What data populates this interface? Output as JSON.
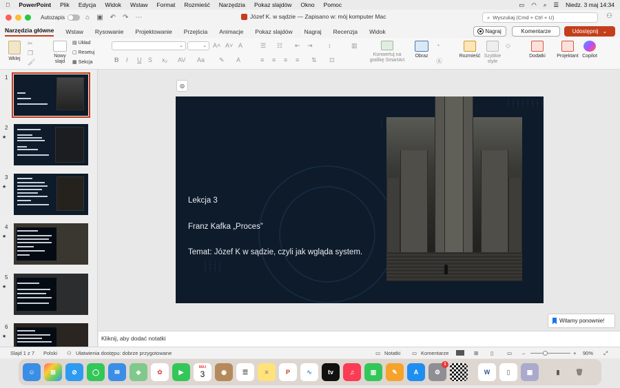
{
  "menubar": {
    "app": "PowerPoint",
    "items": [
      "Plik",
      "Edycja",
      "Widok",
      "Wstaw",
      "Format",
      "Rozmieść",
      "Narzędzia",
      "Pokaz slajdów",
      "Okno",
      "Pomoc"
    ],
    "clock": "Niedz. 3 maj  14:34"
  },
  "titlebar": {
    "autosave": "Autozapis",
    "doc_title": "Józef K. w sądzie — Zapisano w: mój komputer Mac",
    "search_placeholder": "Wyszukaj (Cmd + Ctrl + U)"
  },
  "tabs": [
    "Narzędzia główne",
    "Wstaw",
    "Rysowanie",
    "Projektowanie",
    "Przejścia",
    "Animacje",
    "Pokaz slajdów",
    "Nagraj",
    "Recenzja",
    "Widok"
  ],
  "actions": {
    "record": "Nagraj",
    "comments": "Komentarze",
    "share": "Udostępnij"
  },
  "ribbon": {
    "paste": "Wklej",
    "new_slide": "Nowy\nslajd",
    "layout": "Układ",
    "reset": "Resetuj",
    "section": "Sekcja",
    "smartart": "Konwertuj na\ngrafikę SmartArt",
    "picture": "Obraz",
    "arrange": "Rozmieść",
    "quick_styles": "Szybkie\nstyle",
    "addins": "Dodatki",
    "designer": "Projektant",
    "copilot": "Copilot"
  },
  "slide": {
    "line1": "Lekcja 3",
    "line2": "Franz Kafka „Proces”",
    "line3": "Temat: Józef K w sądzie, czyli jak wgląda system."
  },
  "thumbs": [
    "1",
    "2",
    "3",
    "4",
    "5",
    "6"
  ],
  "welcome": "Witamy ponownie!",
  "notes_placeholder": "Kliknij, aby dodać notatki",
  "status": {
    "slide": "Slajd 1 z 7",
    "lang": "Polski",
    "access": "Ułatwienia dostępu: dobrze przygotowane",
    "notes": "Notatki",
    "comments": "Komentarze",
    "zoom": "90%"
  },
  "dock": {
    "calendar_month": "MAJ",
    "calendar_day": "3",
    "badge": "1"
  }
}
